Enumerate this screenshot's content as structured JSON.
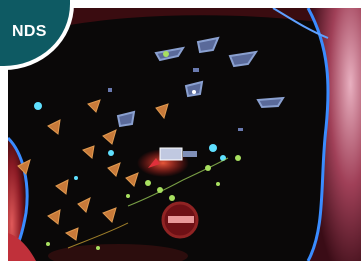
{
  "badge": {
    "label": "NDS"
  },
  "colors": {
    "space": "#0a0808",
    "nebula_red": "#c0303a",
    "nebula_pink": "#d88ca0",
    "shield_blue": "#3a8cff",
    "selection_red": "#e0303a",
    "unit_green": "#a8e060",
    "unit_cyan": "#5fe0ff",
    "badge": "#0e5a63"
  },
  "icons": [
    "enemy-ship-icon",
    "fighter-icon",
    "station-icon",
    "target-reticle-icon"
  ]
}
